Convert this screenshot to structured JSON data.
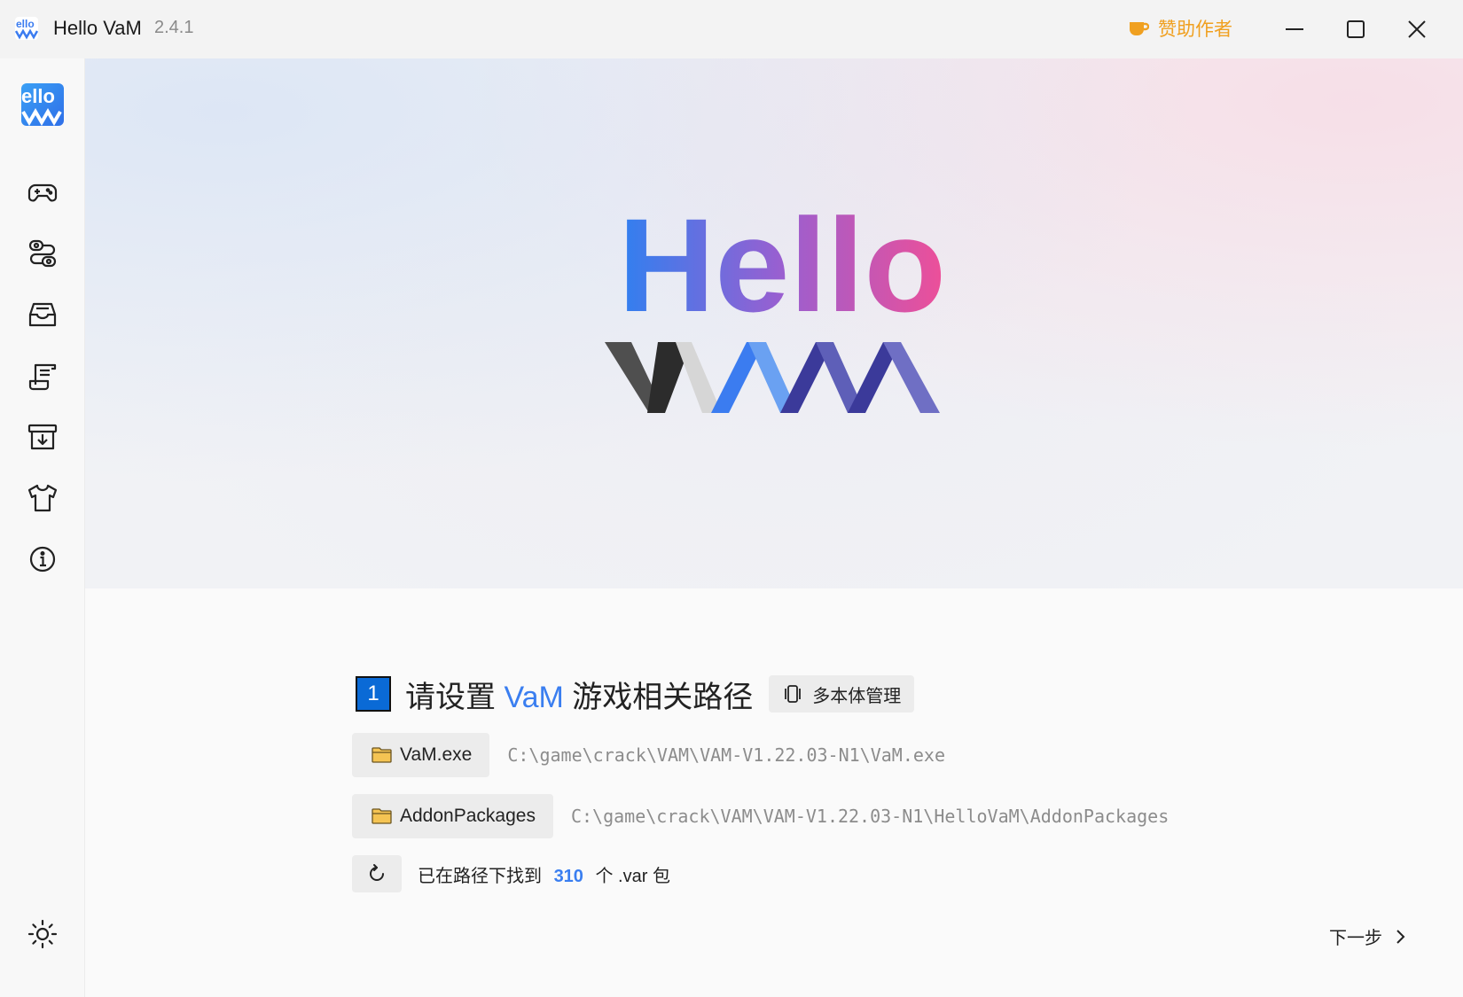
{
  "titlebar": {
    "app_name": "Hello VaM",
    "version": "2.4.1",
    "sponsor_label": "赞助作者"
  },
  "sidebar": {
    "items": [
      {
        "icon": "gamepad-icon"
      },
      {
        "icon": "route-icon"
      },
      {
        "icon": "inbox-tray-icon"
      },
      {
        "icon": "scroll-icon"
      },
      {
        "icon": "archive-download-icon"
      },
      {
        "icon": "tshirt-icon"
      },
      {
        "icon": "info-icon"
      }
    ],
    "bottom_icon": "sun-icon"
  },
  "hero": {
    "logo_line1": "Hello"
  },
  "setup": {
    "step_number": "1",
    "title_before": "请设置",
    "title_highlight": "VaM",
    "title_after": "游戏相关路径",
    "multi_instance_label": "多本体管理",
    "vam_exe_label": "VaM.exe",
    "vam_exe_path": "C:\\game\\crack\\VAM\\VAM-V1.22.03-N1\\VaM.exe",
    "addon_label": "AddonPackages",
    "addon_path": "C:\\game\\crack\\VAM\\VAM-V1.22.03-N1\\HelloVaM\\AddonPackages",
    "found_prefix": "已在路径下找到",
    "found_count": "310",
    "found_suffix": "个 .var 包",
    "next_label": "下一步"
  },
  "colors": {
    "accent": "#3a7ef0",
    "sponsor": "#f0a020",
    "step_badge": "#0a6ad6"
  }
}
